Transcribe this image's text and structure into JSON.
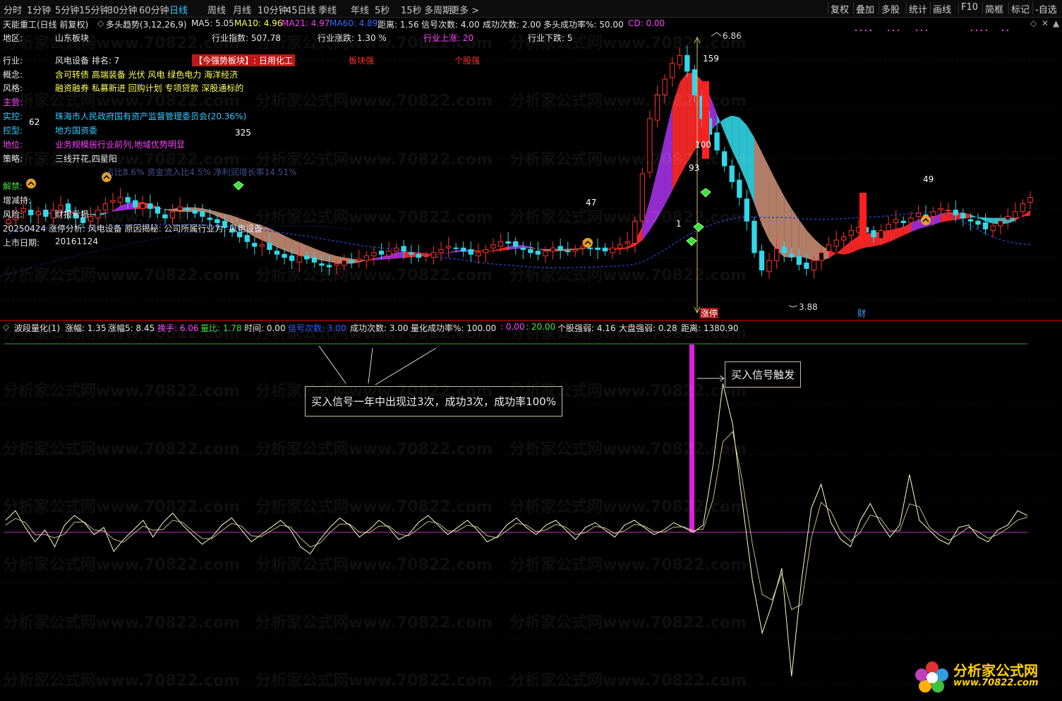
{
  "toolbar": {
    "periods": [
      "分时",
      "1分钟",
      "5分钟",
      "15分钟",
      "30分钟",
      "60分钟",
      "日线",
      "周线",
      "月线",
      "10分钟",
      "45日线",
      "季线",
      "年线",
      "5秒",
      "15秒",
      "多周期",
      "更多 >"
    ],
    "active": "日线",
    "right": [
      "复权",
      "叠加",
      "多股",
      "统计",
      "画线",
      "F10",
      "简框",
      "标记",
      "-自选"
    ]
  },
  "header": {
    "stock": "天能重工(日线 前复权)",
    "indicator": "多头趋势(3,12,26,9)",
    "ma5": "MA5: 5.05",
    "ma10": "MA10: 4.96",
    "ma21": "MA21: 4.97",
    "ma60": "MA60: 4.89",
    "dist": "距离: 1.56",
    "signals": "信号次数: 4.00",
    "success": "成功次数: 2.00",
    "rate": "多头成功率%: 50.00",
    "cd": "CD: 0.00"
  },
  "info": {
    "region_label": "地区:",
    "region": "山东板块",
    "ind_index": "行业指数: 507.78",
    "ind_change": "行业涨跌: 1.30 %",
    "ind_up": "行业上涨: 20",
    "ind_down": "行业下跌: 5",
    "industry_label": "行业:",
    "industry": "风电设备 排名: 7",
    "strong_tag": "【今强势板块】: 日用化工",
    "sector_strong": "板块强",
    "stock_strong": "个股强",
    "concept_label": "概念:",
    "concept": "含可转债 高端装备 光伏 风电 绿色电力 海洋经济",
    "style_label": "风格:",
    "style": "融资融券 私募新进 回购计划 专项贷款 深股通标的",
    "main_label": "主营:",
    "control_label": "实控:",
    "control": "珠海市人民政府国有资产监督管理委员会(20.36%)",
    "type_label": "控型:",
    "type": "地方国资委",
    "position_label": "地位:",
    "position": "业务规模居行业前列,地域优势明显",
    "strategy_label": "策略:",
    "strategy": "三线开花,四星阳",
    "hidden_row": "占比8.6% 资金流入比4.5% 净利润增长率14.51%",
    "unlock_label": "解禁:",
    "reduce_label": "增减持:",
    "risk_label": "风险:",
    "risk": "财报亏损",
    "analysis": "20250424 涨停分析: 风电设备 原因揭秘: 公司所属行业为: 风电设备",
    "list_label": "上市日期:",
    "list_date": "20161124"
  },
  "chart_marks": {
    "peak_label": "6.86",
    "low_label": "3.88",
    "n62": "62",
    "n325": "325",
    "n47": "47",
    "n49": "49",
    "n93": "93",
    "n159": "159",
    "n100": "100",
    "n1": "1",
    "limit_tag": "涨停",
    "fin_tag": "财"
  },
  "osc_header": {
    "name": "波段量化(1)",
    "zf": "涨幅: 1.35",
    "zf5": "涨幅5: 8.45",
    "turnover": "换手: 6.06",
    "vr": "量比: 1.78",
    "time": "时间: 0.00",
    "sig": "信号次数: 3.00",
    "succ": "成功次数: 3.00",
    "qrate": "量化成功率%: 100.00",
    "v1": ": 0.00",
    "v2": ": 20.00",
    "stock_str": "个股强弱: 4.16",
    "market_str": "大盘强弱: 0.28",
    "dist": "距离: 1380.90"
  },
  "annotations": {
    "box1": "买入信号一年中出现过3次，成功3次，成功率100%",
    "box2": "买入信号触发"
  },
  "watermark": "分析家公式网www.70822.com",
  "logo": {
    "name": "分析家公式网",
    "url": "www.70822.com"
  },
  "colors": {
    "up": "#ff3030",
    "down": "#30d0e0",
    "purple": "#a040e0",
    "brown": "#c08070",
    "accent": "#35c8ff",
    "magenta": "#ff30ff"
  }
}
